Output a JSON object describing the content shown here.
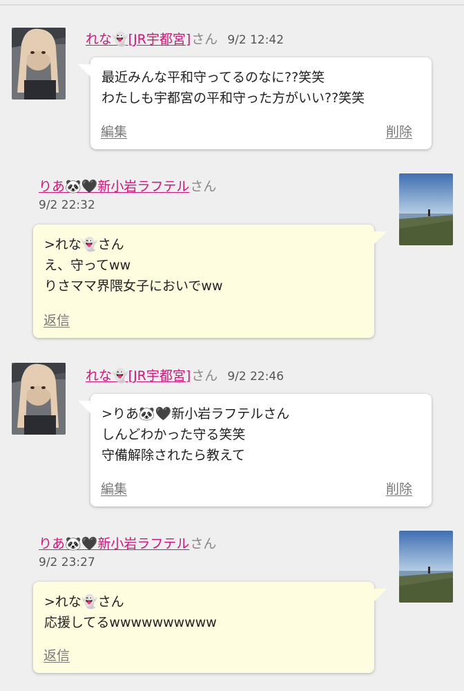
{
  "messages": [
    {
      "author": "れな👻[JR宇都宮]",
      "honorific": "さん",
      "time": "9/2 12:42",
      "lines": [
        "最近みんな平和守ってるのなに??笑笑",
        "わたしも宇都宮の平和守った方がいい??笑笑"
      ],
      "actions": {
        "edit": "編集",
        "delete": "削除"
      }
    },
    {
      "author": "りあ🐼🖤新小岩ラフテル",
      "honorific": "さん",
      "time": "9/2 22:32",
      "lines": [
        ">れな👻さん",
        "え、守ってww",
        "りさママ界隈女子においでww"
      ],
      "actions": {
        "reply": "返信"
      }
    },
    {
      "author": "れな👻[JR宇都宮]",
      "honorific": "さん",
      "time": "9/2 22:46",
      "lines": [
        ">りあ🐼🖤新小岩ラフテルさん",
        "しんどわかった守る笑笑",
        "守備解除されたら教えて"
      ],
      "actions": {
        "edit": "編集",
        "delete": "削除"
      }
    },
    {
      "author": "りあ🐼🖤新小岩ラフテル",
      "honorific": "さん",
      "time": "9/2 23:27",
      "lines": [
        ">れな👻さん",
        "応援してるwwwwwwwwww"
      ],
      "actions": {
        "reply": "返信"
      }
    }
  ],
  "colors": {
    "name_link": "#d4147a",
    "yellow_bubble": "#fffde0",
    "background": "#efefef"
  }
}
